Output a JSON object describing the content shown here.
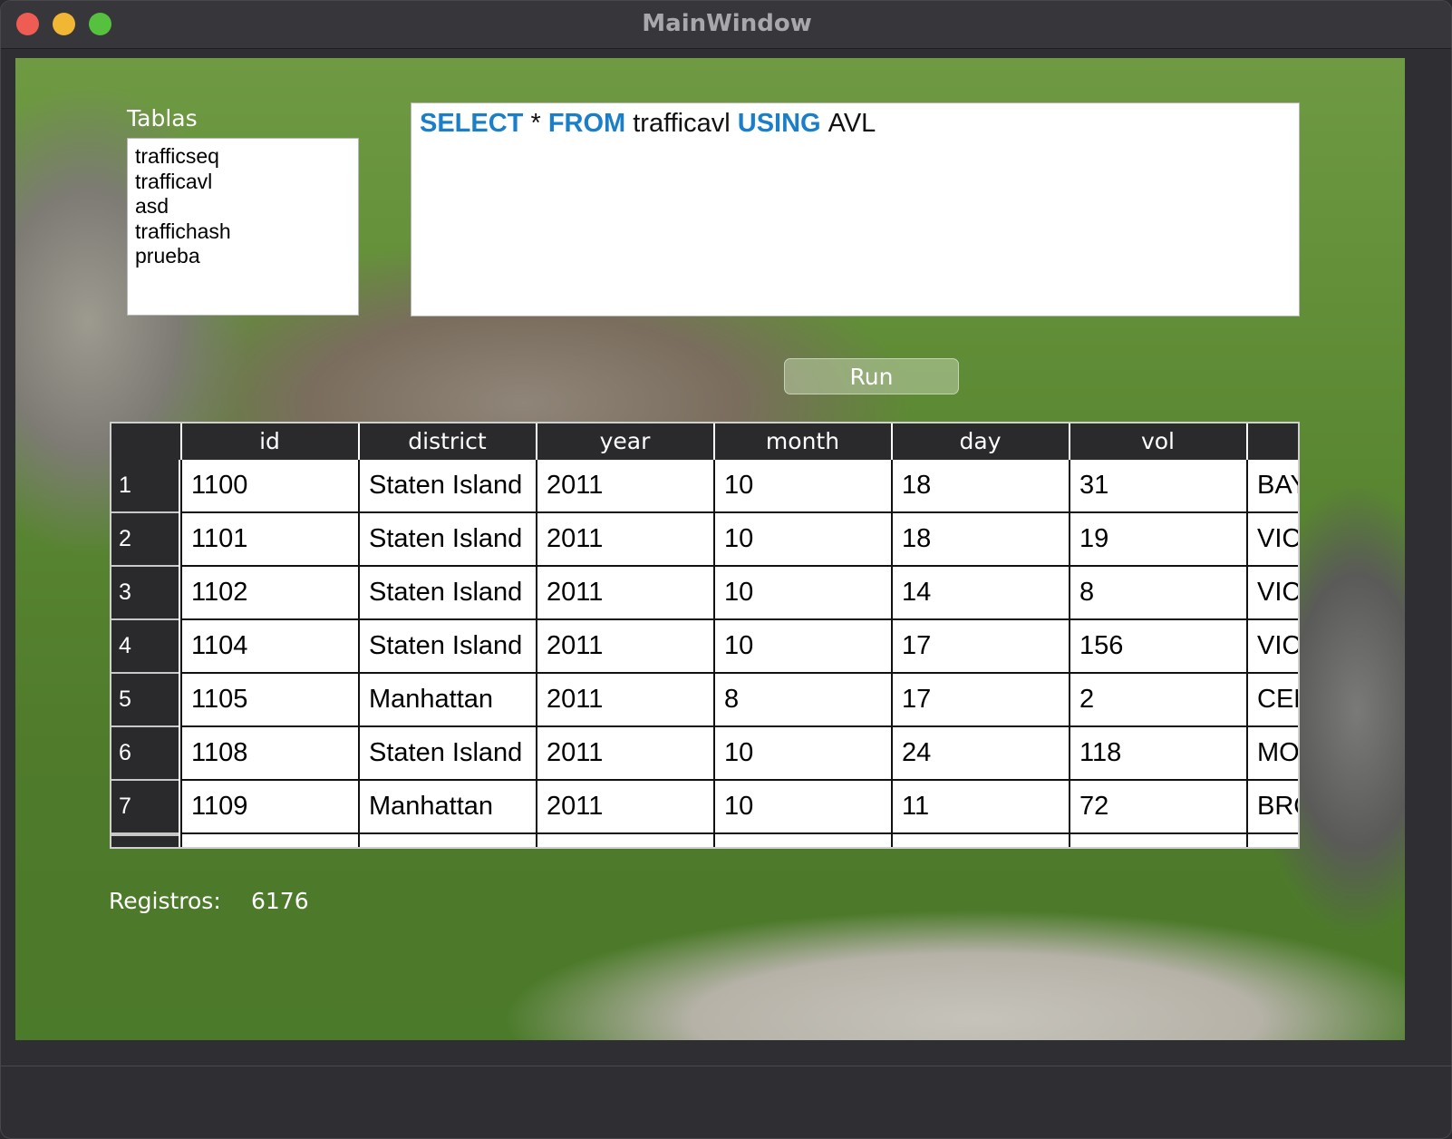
{
  "window": {
    "title": "MainWindow"
  },
  "tables_panel": {
    "label": "Tablas",
    "items": [
      "trafficseq",
      "trafficavl",
      "asd",
      "traffichash",
      "prueba"
    ]
  },
  "query": {
    "tokens": [
      {
        "text": "SELECT",
        "keyword": true
      },
      {
        "text": " * ",
        "keyword": false
      },
      {
        "text": "FROM",
        "keyword": true
      },
      {
        "text": " trafficavl ",
        "keyword": false
      },
      {
        "text": "USING",
        "keyword": true
      },
      {
        "text": " AVL",
        "keyword": false
      }
    ],
    "keyword_color": "#1a7fc8"
  },
  "run_button": {
    "label": "Run"
  },
  "results": {
    "columns": [
      "id",
      "district",
      "year",
      "month",
      "day",
      "vol",
      ""
    ],
    "rows": [
      {
        "num": "1",
        "cells": [
          "1100",
          "Staten Island",
          "2011",
          "10",
          "18",
          "31",
          "BAY"
        ]
      },
      {
        "num": "2",
        "cells": [
          "1101",
          "Staten Island",
          "2011",
          "10",
          "18",
          "19",
          "VIC"
        ]
      },
      {
        "num": "3",
        "cells": [
          "1102",
          "Staten Island",
          "2011",
          "10",
          "14",
          "8",
          "VIC"
        ]
      },
      {
        "num": "4",
        "cells": [
          "1104",
          "Staten Island",
          "2011",
          "10",
          "17",
          "156",
          "VIC"
        ]
      },
      {
        "num": "5",
        "cells": [
          "1105",
          "Manhattan",
          "2011",
          "8",
          "17",
          "2",
          "CEN"
        ]
      },
      {
        "num": "6",
        "cells": [
          "1108",
          "Staten Island",
          "2011",
          "10",
          "24",
          "118",
          "MO"
        ]
      },
      {
        "num": "7",
        "cells": [
          "1109",
          "Manhattan",
          "2011",
          "10",
          "11",
          "72",
          "BRO"
        ]
      }
    ]
  },
  "record_count": {
    "label": "Registros:",
    "value": "6176"
  }
}
